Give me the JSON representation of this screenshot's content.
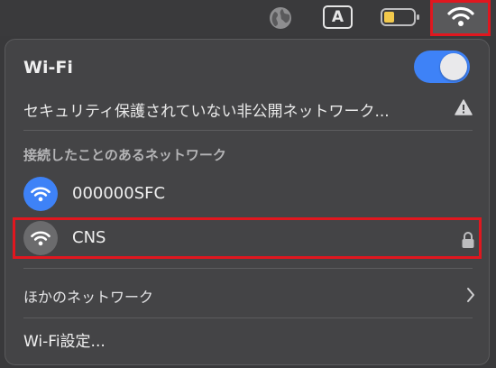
{
  "menubar": {
    "globe_icon": "globe-icon",
    "input_source_label": "A",
    "battery_icon": "battery-icon",
    "wifi_icon": "wifi-icon",
    "highlight_color": "#e0171f"
  },
  "panel": {
    "title": "Wi-Fi",
    "toggle_on": true,
    "toggle_color": "#3e82f7",
    "private_network_label": "セキュリティ保護されていない非公開ネットワーク...",
    "private_network_icon": "warning-icon",
    "known_networks_header": "接続したことのあるネットワーク",
    "networks": [
      {
        "name": "000000SFC",
        "connected": true,
        "icon": "wifi-icon"
      },
      {
        "name": "CNS",
        "connected": false,
        "secured": true,
        "icon": "wifi-icon",
        "lock_icon": "lock-icon"
      }
    ],
    "other_networks_label": "ほかのネットワーク",
    "other_networks_icon": "chevron-right-icon",
    "settings_label": "Wi-Fi設定..."
  }
}
